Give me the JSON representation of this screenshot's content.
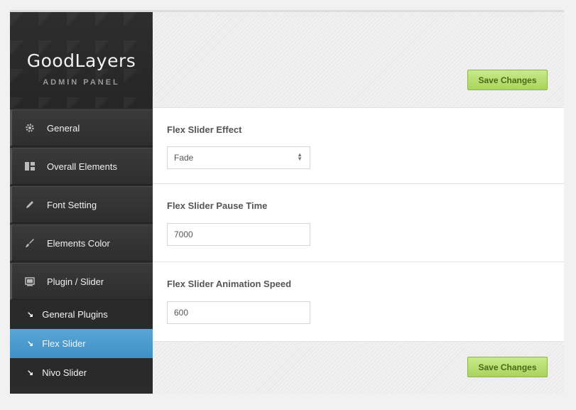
{
  "brand": {
    "title": "GoodLayers",
    "subtitle": "ADMIN PANEL"
  },
  "sidebar": {
    "items": [
      {
        "label": "General",
        "icon": "gear-icon"
      },
      {
        "label": "Overall Elements",
        "icon": "layout-icon"
      },
      {
        "label": "Font Setting",
        "icon": "pencil-icon"
      },
      {
        "label": "Elements Color",
        "icon": "brush-icon"
      },
      {
        "label": "Plugin / Slider",
        "icon": "slider-icon"
      }
    ],
    "subitems": [
      {
        "label": "General Plugins",
        "active": false
      },
      {
        "label": "Flex Slider",
        "active": true
      },
      {
        "label": "Nivo Slider",
        "active": false
      }
    ]
  },
  "toolbar": {
    "save_label": "Save Changes"
  },
  "settings": {
    "effect": {
      "label": "Flex Slider Effect",
      "value": "Fade"
    },
    "pause_time": {
      "label": "Flex Slider Pause Time",
      "value": "7000"
    },
    "animation_speed": {
      "label": "Flex Slider Animation Speed",
      "value": "600"
    }
  },
  "colors": {
    "accent": "#4a9bcf",
    "save_button": "#b5dd6e",
    "sidebar_bg": "#2b2b2b"
  }
}
